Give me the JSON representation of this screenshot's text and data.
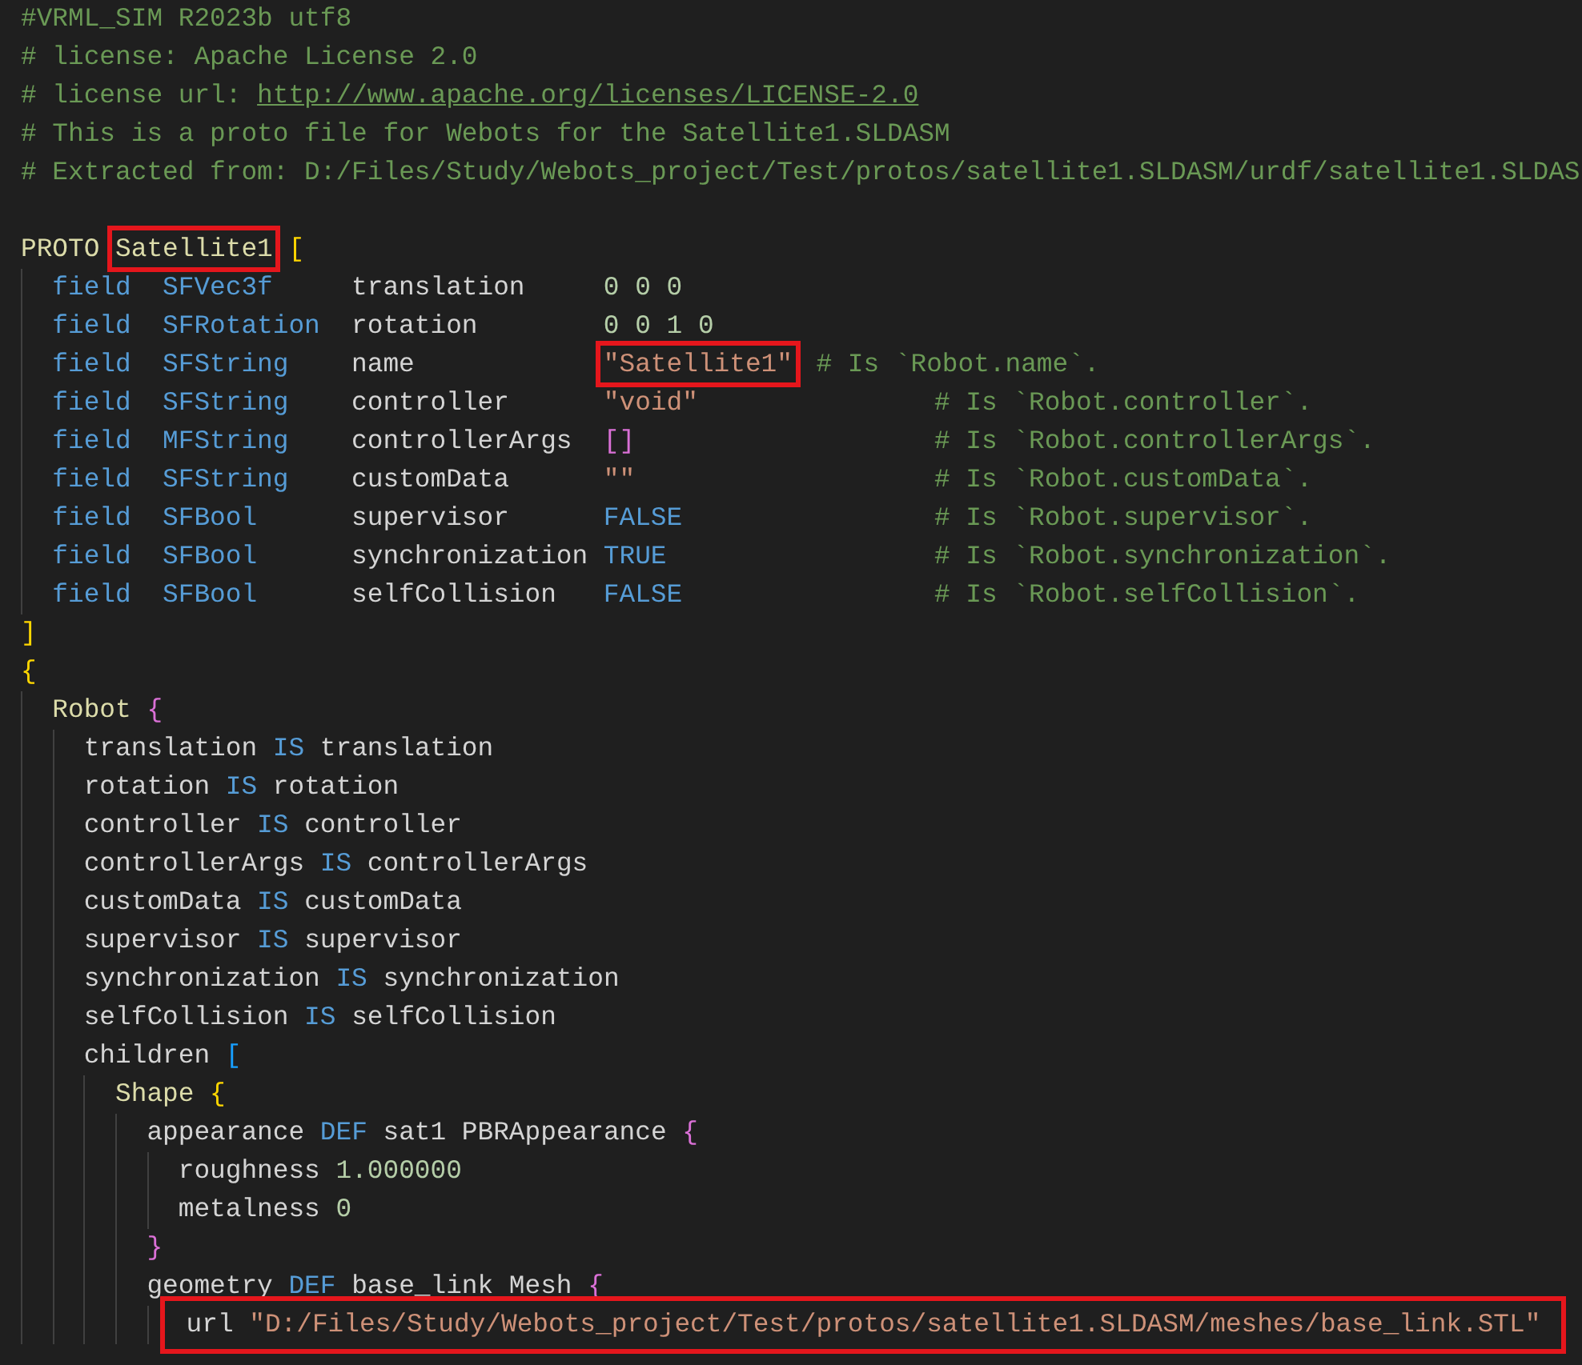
{
  "code": [
    {
      "kind": "code",
      "tokens": [
        {
          "text": "#VRML_SIM R2023b utf8",
          "kind": "comment"
        }
      ]
    },
    {
      "kind": "code",
      "tokens": [
        {
          "text": "# license: Apache License 2.0",
          "kind": "comment"
        }
      ]
    },
    {
      "kind": "code",
      "tokens": [
        {
          "text": "# license url:",
          "kind": "comment"
        },
        {
          "text": "http://www.apache.org/licenses/LICENSE-2.0",
          "kind": "link"
        }
      ]
    },
    {
      "kind": "code",
      "tokens": [
        {
          "text": "# This is a proto file for Webots for the Satellite1.SLDASM",
          "kind": "comment"
        }
      ]
    },
    {
      "kind": "code",
      "tokens": [
        {
          "text": "# Extracted from: D:/Files/Study/Webots_project/Test/protos/satellite1.SLDASM/urdf/satellite1.SLDAS",
          "kind": "comment"
        }
      ]
    },
    {
      "kind": "blank"
    },
    {
      "kind": "code",
      "tokens": [
        {
          "text": "PROTO",
          "kind": "node"
        },
        {
          "text": "Satellite1",
          "kind": "node",
          "highlighted": true
        },
        {
          "text": "[",
          "kind": "bracket1"
        }
      ],
      "children": [
        {
          "kind": "field",
          "keyword": "field",
          "type": "SFVec3f",
          "name": "translation",
          "value": [
            {
              "text": "0 0 0",
              "kind": "number"
            }
          ]
        },
        {
          "kind": "field",
          "keyword": "field",
          "type": "SFRotation",
          "name": "rotation",
          "value": [
            {
              "text": "0 0 1 0",
              "kind": "number"
            }
          ]
        },
        {
          "kind": "field",
          "keyword": "field",
          "type": "SFString",
          "name": "name",
          "value": [
            {
              "text": "\"Satellite1\"",
              "kind": "string",
              "highlighted": true
            }
          ],
          "comment": "# Is `Robot.name`.",
          "comment_aligned": false
        },
        {
          "kind": "field",
          "keyword": "field",
          "type": "SFString",
          "name": "controller",
          "value": [
            {
              "text": "\"void\"",
              "kind": "string"
            }
          ],
          "comment": "# Is `Robot.controller`.",
          "comment_aligned": true
        },
        {
          "kind": "field",
          "keyword": "field",
          "type": "MFString",
          "name": "controllerArgs",
          "value": [
            {
              "text": "[]",
              "kind": "bracket2"
            }
          ],
          "comment": "# Is `Robot.controllerArgs`.",
          "comment_aligned": true
        },
        {
          "kind": "field",
          "keyword": "field",
          "type": "SFString",
          "name": "customData",
          "value": [
            {
              "text": "\"\"",
              "kind": "string"
            }
          ],
          "comment": "# Is `Robot.customData`.",
          "comment_aligned": true
        },
        {
          "kind": "field",
          "keyword": "field",
          "type": "SFBool",
          "name": "supervisor",
          "value": [
            {
              "text": "FALSE",
              "kind": "keyword"
            }
          ],
          "comment": "# Is `Robot.supervisor`.",
          "comment_aligned": true
        },
        {
          "kind": "field",
          "keyword": "field",
          "type": "SFBool",
          "name": "synchronization",
          "value": [
            {
              "text": "TRUE",
              "kind": "keyword"
            }
          ],
          "comment": "# Is `Robot.synchronization`.",
          "comment_aligned": true
        },
        {
          "kind": "field",
          "keyword": "field",
          "type": "SFBool",
          "name": "selfCollision",
          "value": [
            {
              "text": "FALSE",
              "kind": "keyword"
            }
          ],
          "comment": "# Is `Robot.selfCollision`.",
          "comment_aligned": true
        }
      ]
    },
    {
      "kind": "code",
      "tokens": [
        {
          "text": "]",
          "kind": "bracket1"
        }
      ]
    },
    {
      "kind": "code",
      "tokens": [
        {
          "text": "{",
          "kind": "bracket1"
        }
      ],
      "children": [
        {
          "kind": "code",
          "tokens": [
            {
              "text": "Robot",
              "kind": "node"
            },
            {
              "text": "{",
              "kind": "bracket2"
            }
          ],
          "children": [
            {
              "kind": "code",
              "tokens": [
                {
                  "text": "translation",
                  "kind": "plain"
                },
                {
                  "text": "IS",
                  "kind": "keyword"
                },
                {
                  "text": "translation",
                  "kind": "plain"
                }
              ]
            },
            {
              "kind": "code",
              "tokens": [
                {
                  "text": "rotation",
                  "kind": "plain"
                },
                {
                  "text": "IS",
                  "kind": "keyword"
                },
                {
                  "text": "rotation",
                  "kind": "plain"
                }
              ]
            },
            {
              "kind": "code",
              "tokens": [
                {
                  "text": "controller",
                  "kind": "plain"
                },
                {
                  "text": "IS",
                  "kind": "keyword"
                },
                {
                  "text": "controller",
                  "kind": "plain"
                }
              ]
            },
            {
              "kind": "code",
              "tokens": [
                {
                  "text": "controllerArgs",
                  "kind": "plain"
                },
                {
                  "text": "IS",
                  "kind": "keyword"
                },
                {
                  "text": "controllerArgs",
                  "kind": "plain"
                }
              ]
            },
            {
              "kind": "code",
              "tokens": [
                {
                  "text": "customData",
                  "kind": "plain"
                },
                {
                  "text": "IS",
                  "kind": "keyword"
                },
                {
                  "text": "customData",
                  "kind": "plain"
                }
              ]
            },
            {
              "kind": "code",
              "tokens": [
                {
                  "text": "supervisor",
                  "kind": "plain"
                },
                {
                  "text": "IS",
                  "kind": "keyword"
                },
                {
                  "text": "supervisor",
                  "kind": "plain"
                }
              ]
            },
            {
              "kind": "code",
              "tokens": [
                {
                  "text": "synchronization",
                  "kind": "plain"
                },
                {
                  "text": "IS",
                  "kind": "keyword"
                },
                {
                  "text": "synchronization",
                  "kind": "plain"
                }
              ]
            },
            {
              "kind": "code",
              "tokens": [
                {
                  "text": "selfCollision",
                  "kind": "plain"
                },
                {
                  "text": "IS",
                  "kind": "keyword"
                },
                {
                  "text": "selfCollision",
                  "kind": "plain"
                }
              ]
            },
            {
              "kind": "code",
              "tokens": [
                {
                  "text": "children",
                  "kind": "plain"
                },
                {
                  "text": "[",
                  "kind": "bracket3"
                }
              ],
              "children": [
                {
                  "kind": "code",
                  "tokens": [
                    {
                      "text": "Shape",
                      "kind": "node"
                    },
                    {
                      "text": "{",
                      "kind": "bracket1"
                    }
                  ],
                  "children": [
                    {
                      "kind": "code",
                      "tokens": [
                        {
                          "text": "appearance",
                          "kind": "plain"
                        },
                        {
                          "text": "DEF",
                          "kind": "keyword"
                        },
                        {
                          "text": "sat1",
                          "kind": "plain"
                        },
                        {
                          "text": "PBRAppearance",
                          "kind": "plain"
                        },
                        {
                          "text": "{",
                          "kind": "bracket2"
                        }
                      ],
                      "children": [
                        {
                          "kind": "code",
                          "tokens": [
                            {
                              "text": "roughness",
                              "kind": "plain"
                            },
                            {
                              "text": "1.000000",
                              "kind": "number"
                            }
                          ]
                        },
                        {
                          "kind": "code",
                          "tokens": [
                            {
                              "text": "metalness",
                              "kind": "plain"
                            },
                            {
                              "text": "0",
                              "kind": "number"
                            }
                          ]
                        }
                      ]
                    },
                    {
                      "kind": "code",
                      "tokens": [
                        {
                          "text": "}",
                          "kind": "bracket2"
                        }
                      ]
                    },
                    {
                      "kind": "code",
                      "tokens": [
                        {
                          "text": "geometry",
                          "kind": "plain"
                        },
                        {
                          "text": "DEF",
                          "kind": "keyword"
                        },
                        {
                          "text": "base_link",
                          "kind": "plain"
                        },
                        {
                          "text": "Mesh",
                          "kind": "plain"
                        },
                        {
                          "text": "{",
                          "kind": "bracket2"
                        }
                      ],
                      "children": [
                        {
                          "kind": "code",
                          "highlighted": true,
                          "tokens": [
                            {
                              "text": "url",
                              "kind": "plain"
                            },
                            {
                              "text": "\"D:/Files/Study/Webots_project/Test/protos/satellite1.SLDASM/meshes/base_link.STL\"",
                              "kind": "string"
                            }
                          ]
                        }
                      ]
                    }
                  ]
                }
              ]
            }
          ]
        }
      ]
    }
  ]
}
